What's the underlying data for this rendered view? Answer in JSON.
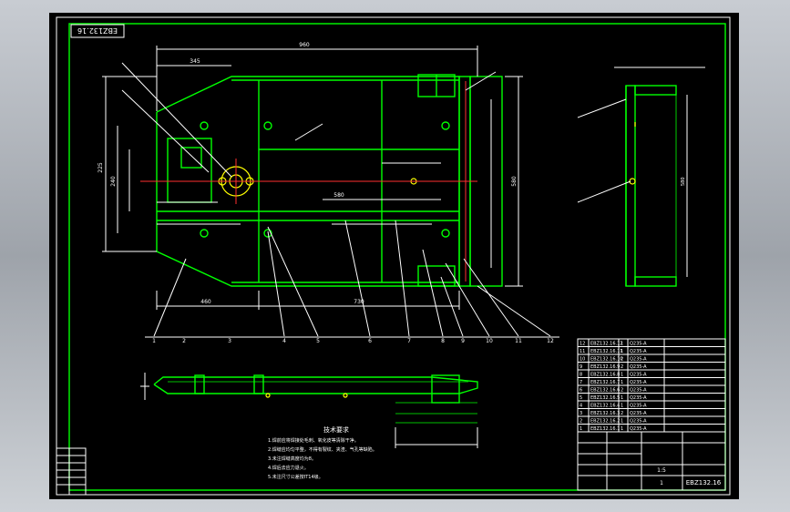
{
  "drawing": {
    "stamp_code": "EBZ132.16",
    "drawing_number": "EBZ132.16",
    "notes_title": "技术要求",
    "notes": [
      "1.焊前应将焊接处毛刺、氧化皮等清除干净。",
      "2.焊缝应均匀平整，不得有裂纹、夹渣、气孔等缺陷。",
      "3.未注焊缝高度均为8。",
      "4.焊后去应力退火。",
      "5.未注尺寸公差按IT14级。"
    ],
    "scale": "1:5",
    "sheet": "1"
  },
  "colors": {
    "background": "#000000",
    "frame": "#ffffff",
    "geometry": "#00ff00",
    "centerline": "#ff3030",
    "markers": "#ffff00"
  },
  "balloons": [
    "1",
    "2",
    "3",
    "4",
    "5",
    "6",
    "7",
    "8",
    "9",
    "10",
    "11",
    "12"
  ],
  "dimensions": {
    "overall_length": "960",
    "left_offset": "345",
    "height": "580",
    "bottom_1": "460",
    "bottom_2": "730",
    "width_1": "225",
    "width_2": "240",
    "middle": "580"
  },
  "bom_rows": [
    [
      "12",
      "EBZ132.16.12",
      "1",
      "Q235-A"
    ],
    [
      "11",
      "EBZ132.16.11",
      "1",
      "Q235-A"
    ],
    [
      "10",
      "EBZ132.16.10",
      "2",
      "Q235-A"
    ],
    [
      "9",
      "EBZ132.16.9",
      "2",
      "Q235-A"
    ],
    [
      "8",
      "EBZ132.16.8",
      "1",
      "Q235-A"
    ],
    [
      "7",
      "EBZ132.16.7",
      "1",
      "Q235-A"
    ],
    [
      "6",
      "EBZ132.16.6",
      "2",
      "Q235-A"
    ],
    [
      "5",
      "EBZ132.16.5",
      "1",
      "Q235-A"
    ],
    [
      "4",
      "EBZ132.16.4",
      "1",
      "Q235-A"
    ],
    [
      "3",
      "EBZ132.16.3",
      "2",
      "Q235-A"
    ],
    [
      "2",
      "EBZ132.16.2",
      "1",
      "Q235-A"
    ],
    [
      "1",
      "EBZ132.16.1",
      "1",
      "Q235-A"
    ]
  ]
}
